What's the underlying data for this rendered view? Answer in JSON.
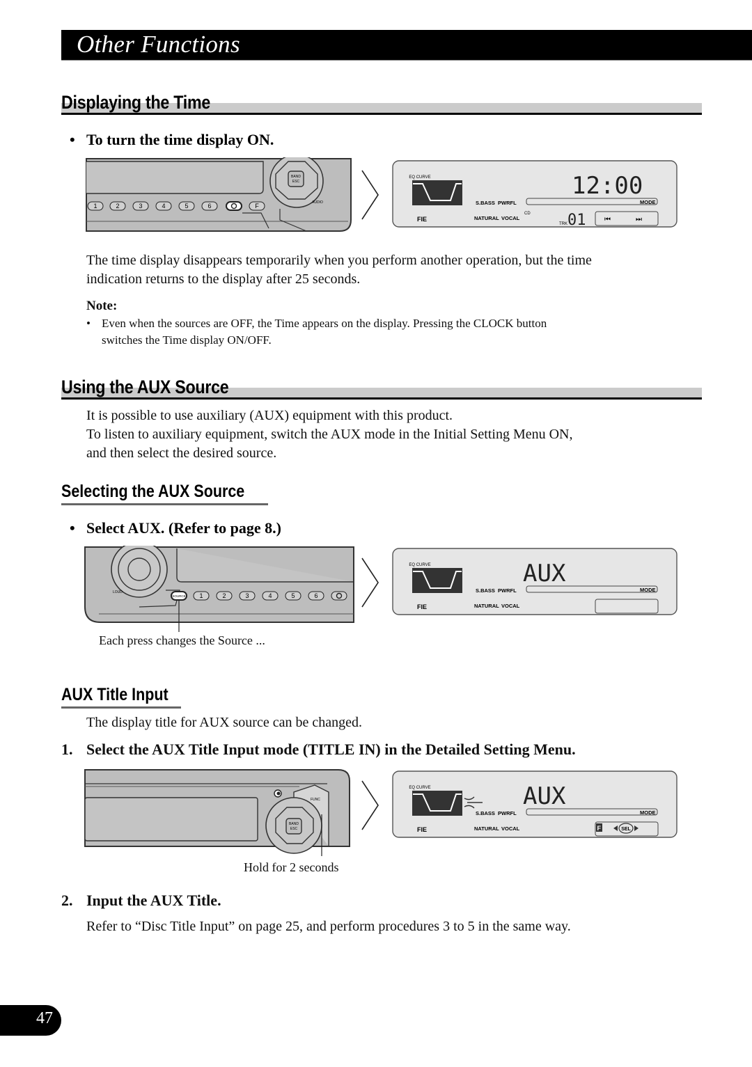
{
  "banner": {
    "title": "Other Functions"
  },
  "sections": {
    "displaying_time": {
      "title": "Displaying the Time",
      "bullet": "To turn the time display ON.",
      "body": [
        "The time display disappears temporarily when you perform another operation, but the time",
        "indication returns to the display after 25 seconds."
      ],
      "note_label": "Note:",
      "note_items": [
        [
          "Even when the sources are OFF, the Time appears on the display. Pressing the CLOCK button",
          "switches the Time display ON/OFF."
        ]
      ]
    },
    "using_aux": {
      "title": "Using the AUX Source",
      "body": [
        "It is possible to use auxiliary (AUX) equipment with this product.",
        "To listen to auxiliary equipment, switch the AUX mode in the Initial Setting Menu ON,",
        "and then select the desired source."
      ]
    },
    "selecting_aux": {
      "title": "Selecting the AUX Source",
      "bullet": "Select AUX. (Refer to page 8.)",
      "caption": "Each press changes the Source ..."
    },
    "aux_title_input": {
      "title": "AUX Title Input",
      "body": "The display title for AUX source can be changed.",
      "steps": [
        {
          "num": "1.",
          "text": "Select the AUX Title Input mode (TITLE IN) in the Detailed Setting Menu."
        },
        {
          "num": "2.",
          "text": "Input the AUX Title."
        }
      ],
      "caption": "Hold for 2 seconds",
      "step2_body": "Refer to “Disc Title Input” on page 25, and perform procedures 3 to 5 in the same way."
    }
  },
  "unit": {
    "preset_buttons": [
      "1",
      "2",
      "3",
      "4",
      "5",
      "6"
    ],
    "band_esc": [
      "BAND",
      "ESC"
    ],
    "audio_label": "AUDIO",
    "loud_label": "LOUD",
    "source_label": "SOURCE",
    "func_label": "FUNC"
  },
  "lcd": {
    "eq_curve": "EQ CURVE",
    "sbass": "S.BASS",
    "pwrfl": "PWRFL",
    "natural": "NATURAL",
    "vocal": "VOCAL",
    "fie": "FIE",
    "mode": "MODE",
    "cd": "CD",
    "trk": "TRK",
    "time": "12:00",
    "track": "01",
    "aux": "AUX",
    "f_label": "F",
    "sel": "SEL"
  },
  "page_number": "47",
  "colors": {
    "banner": "#000000",
    "heading_band": "#cbcbcb",
    "panel_gray": "#bdbdbd",
    "lcd_bg": "#e6e6e6"
  }
}
